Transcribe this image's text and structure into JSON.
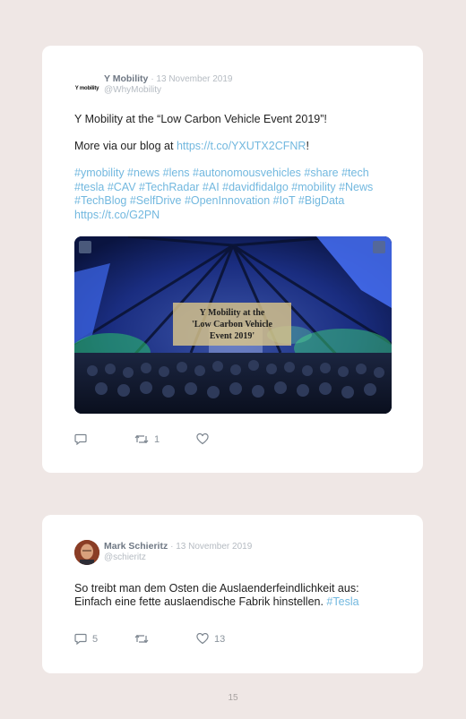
{
  "tweets": [
    {
      "avatar_text": "Y mobility",
      "name": "Y Mobility",
      "date": "· 13 November 2019",
      "handle": "@WhyMobility",
      "line1": "Y Mobility at the “Low Carbon Vehicle Event 2019”!",
      "line2_prefix": "More via our blog at ",
      "line2_link": "https://t.co/YXUTX2CFNR",
      "line2_suffix": "!",
      "hashtags": "#ymobility #news #lens #autonomousvehicles #share #tech #tesla #CAV #TechRadar #AI #davidfidalgo #mobility #News #TechBlog #SelfDrive #OpenInnovation #IoT #BigData https://t.co/G2PN",
      "media_overlay": [
        "Y Mobility at the",
        "'Low Carbon Vehicle",
        "Event 2019'"
      ],
      "reply_count": "",
      "retweet_count": "1",
      "like_count": ""
    },
    {
      "name": "Mark Schieritz",
      "date": "· 13 November 2019",
      "handle": "@schieritz",
      "line1": "So treibt man dem Osten die Auslaenderfeindlichkeit aus:",
      "line2_prefix": "Einfach eine fette auslaendische Fabrik hinstellen. ",
      "line2_link": "#Tesla",
      "reply_count": "5",
      "retweet_count": "",
      "like_count": "13"
    }
  ],
  "page_number": "15",
  "colors": {
    "background": "#efe7e5",
    "link": "#72b8df",
    "card": "#ffffff"
  },
  "icons": [
    "reply-icon",
    "retweet-icon",
    "like-icon"
  ]
}
